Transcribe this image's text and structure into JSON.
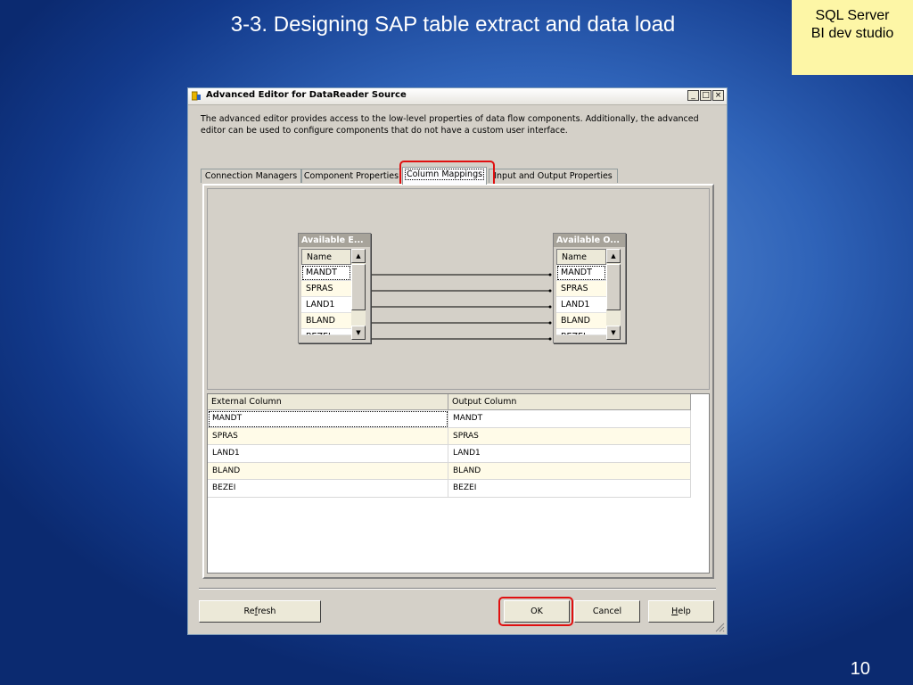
{
  "slide": {
    "title": "3-3. Designing SAP table extract and data load",
    "corner_note_line1": "SQL Server",
    "corner_note_line2": "BI dev studio",
    "page_number": "10"
  },
  "dialog": {
    "title": "Advanced Editor for DataReader Source",
    "window_buttons": {
      "minimize": "_",
      "maximize": "□",
      "close": "×"
    },
    "description": "The advanced editor provides access to the low-level properties of data flow components. Additionally, the advanced editor can be used to configure components that do not have a custom user interface.",
    "tabs": [
      {
        "label": "Connection Managers"
      },
      {
        "label": "Component Properties"
      },
      {
        "label": "Column Mappings"
      },
      {
        "label": "Input and Output Properties"
      }
    ],
    "active_tab": "Column Mappings",
    "mapping": {
      "left_box": {
        "title": "Available E...",
        "header": "Name",
        "rows": [
          "MANDT",
          "SPRAS",
          "LAND1",
          "BLAND",
          "BEZEI"
        ]
      },
      "right_box": {
        "title": "Available O...",
        "header": "Name",
        "rows": [
          "MANDT",
          "SPRAS",
          "LAND1",
          "BLAND",
          "BEZEI"
        ]
      }
    },
    "grid": {
      "columns": [
        "External Column",
        "Output Column"
      ],
      "rows": [
        [
          "MANDT",
          "MANDT"
        ],
        [
          "SPRAS",
          "SPRAS"
        ],
        [
          "LAND1",
          "LAND1"
        ],
        [
          "BLAND",
          "BLAND"
        ],
        [
          "BEZEI",
          "BEZEI"
        ]
      ]
    },
    "buttons": {
      "refresh_pre": "Re",
      "refresh_key": "f",
      "refresh_post": "resh",
      "ok": "OK",
      "cancel": "Cancel",
      "help_key": "H",
      "help_post": "elp"
    }
  },
  "colors": {
    "highlight": "#e01010",
    "corner_note_bg": "#fdf6a6"
  }
}
